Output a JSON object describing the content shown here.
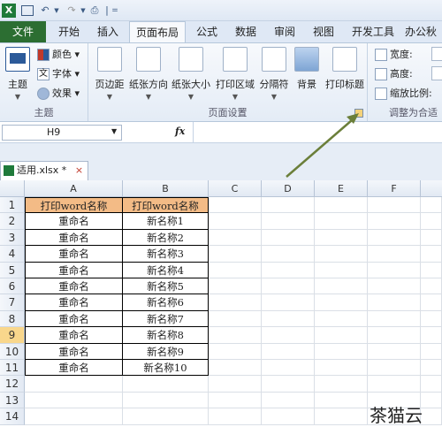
{
  "qat": {
    "undo_sep": "|",
    "customize": "="
  },
  "tabs": {
    "file": "文件",
    "items": [
      "开始",
      "插入",
      "页面布局",
      "公式",
      "数据",
      "审阅",
      "视图",
      "开发工具",
      "办公秋"
    ]
  },
  "ribbon": {
    "theme": {
      "themes": "主题",
      "colors": "颜色",
      "fonts": "字体",
      "effects": "效果",
      "group": "主题"
    },
    "page_setup": {
      "margins": "页边距",
      "orientation": "纸张方向",
      "size": "纸张大小",
      "print_area": "打印区域",
      "breaks": "分隔符",
      "background": "背景",
      "print_titles": "打印标题",
      "group": "页面设置"
    },
    "scale": {
      "width": "宽度:",
      "height": "高度:",
      "scale": "缩放比例:",
      "group": "调整为合适"
    }
  },
  "formula_bar": {
    "name_box": "H9",
    "fx": "fx"
  },
  "workbook": {
    "tab": "适用.xlsx *",
    "close": "×"
  },
  "sheet": {
    "columns": [
      "A",
      "B",
      "C",
      "D",
      "E",
      "F"
    ],
    "rows": [
      "1",
      "2",
      "3",
      "4",
      "5",
      "6",
      "7",
      "8",
      "9",
      "10",
      "11",
      "12",
      "13",
      "14"
    ],
    "data": [
      [
        "打印word名称",
        "打印word名称"
      ],
      [
        "重命名",
        "新名称1"
      ],
      [
        "重命名",
        "新名称2"
      ],
      [
        "重命名",
        "新名称3"
      ],
      [
        "重命名",
        "新名称4"
      ],
      [
        "重命名",
        "新名称5"
      ],
      [
        "重命名",
        "新名称6"
      ],
      [
        "重命名",
        "新名称7"
      ],
      [
        "重命名",
        "新名称8"
      ],
      [
        "重命名",
        "新名称9"
      ],
      [
        "重命名",
        "新名称10"
      ]
    ],
    "selected_row": "9",
    "header_color": "#f3bb86"
  },
  "watermark": "茶猫云",
  "colors": {
    "file_tab": "#2c6e32",
    "arrow": "#6b7f3a",
    "ribbon": "#e4ecf6"
  }
}
